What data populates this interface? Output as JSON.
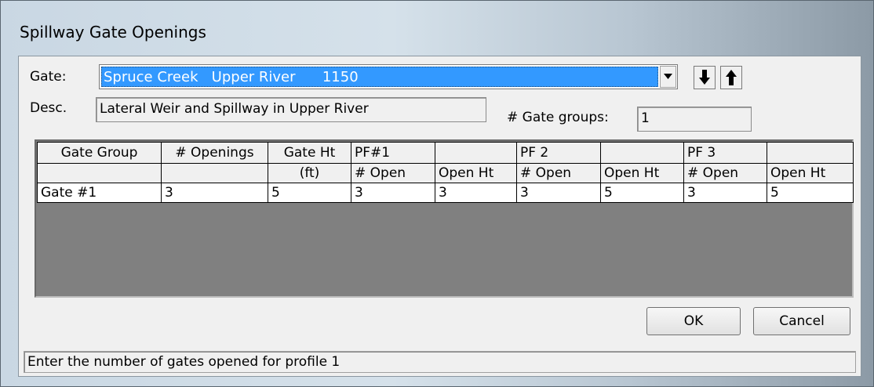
{
  "window": {
    "title": "Spillway Gate Openings"
  },
  "gate": {
    "label": "Gate:",
    "selected": "Spruce Creek   Upper River      1150",
    "dropdown_icon": "chevron-down-icon",
    "down_icon": "arrow-down-icon",
    "up_icon": "arrow-up-icon"
  },
  "desc": {
    "label": "Desc.",
    "value": "Lateral Weir and Spillway in Upper River"
  },
  "gate_groups": {
    "label": "# Gate groups:",
    "value": "1"
  },
  "table": {
    "header_row1": [
      "Gate Group",
      "# Openings",
      "Gate Ht",
      "PF#1",
      "",
      "PF 2",
      "",
      "PF 3",
      ""
    ],
    "header_row2": [
      "",
      "",
      "(ft)",
      "# Open",
      "Open Ht",
      "# Open",
      "Open Ht",
      "# Open",
      "Open Ht"
    ],
    "rows": [
      [
        "Gate #1",
        "3",
        "5",
        "3",
        "3",
        "3",
        "5",
        "3",
        "5"
      ]
    ]
  },
  "buttons": {
    "ok": "OK",
    "cancel": "Cancel"
  },
  "status": "Enter the number of gates opened for profile 1"
}
